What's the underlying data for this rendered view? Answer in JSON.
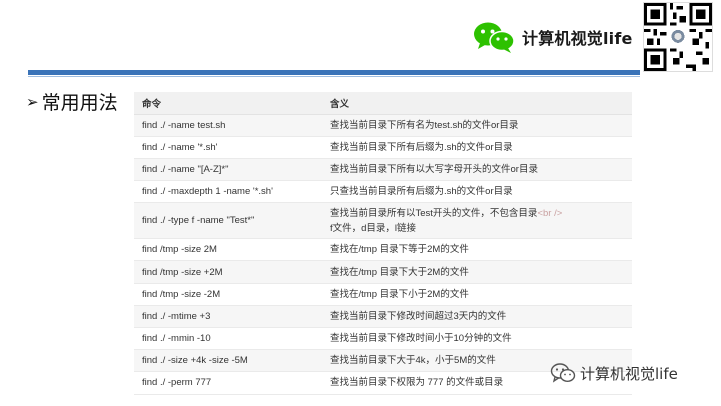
{
  "header": {
    "brand_name": "计算机视觉life",
    "brand_color": "#2dc100",
    "accent_bar_color": "#3a73b8"
  },
  "section": {
    "title": "常用用法",
    "bullet_icon": "arrow-bullet-icon"
  },
  "table": {
    "columns": [
      "命令",
      "含义"
    ],
    "rows": [
      {
        "cmd": "find ./ -name test.sh",
        "desc": "查找当前目录下所有名为test.sh的文件or目录"
      },
      {
        "cmd": "find ./ -name '*.sh'",
        "desc": "查找当前目录下所有后缀为.sh的文件or目录"
      },
      {
        "cmd": "find ./ -name \"[A-Z]*\"",
        "desc": "查找当前目录下所有以大写字母开头的文件or目录"
      },
      {
        "cmd": "find ./ -maxdepth 1 -name '*.sh'",
        "desc": "只查找当前目录所有后缀为.sh的文件or目录"
      },
      {
        "cmd": "find ./ -type f -name \"Test*\"",
        "desc": "查找当前目录所有以Test开头的文件，不包含目录",
        "desc_tag": "<br />",
        "desc2": "f文件，d目录，l链接"
      },
      {
        "cmd": "find /tmp -size 2M",
        "desc": "查找在/tmp 目录下等于2M的文件"
      },
      {
        "cmd": "find /tmp -size +2M",
        "desc": "查找在/tmp 目录下大于2M的文件"
      },
      {
        "cmd": "find /tmp -size -2M",
        "desc": "查找在/tmp 目录下小于2M的文件"
      },
      {
        "cmd": "find ./ -mtime +3",
        "desc": "查找当前目录下修改时间超过3天内的文件"
      },
      {
        "cmd": "find ./ -mmin -10",
        "desc": "查找当前目录下修改时间小于10分钟的文件"
      },
      {
        "cmd": "find ./ -size +4k -size -5M",
        "desc": "查找当前目录下大于4k，小于5M的文件"
      },
      {
        "cmd": "find ./ -perm 777",
        "desc": "查找当前目录下权限为 777 的文件或目录"
      }
    ]
  },
  "footer": {
    "brand_name": "计算机视觉life",
    "icon": "wechat-icon"
  }
}
